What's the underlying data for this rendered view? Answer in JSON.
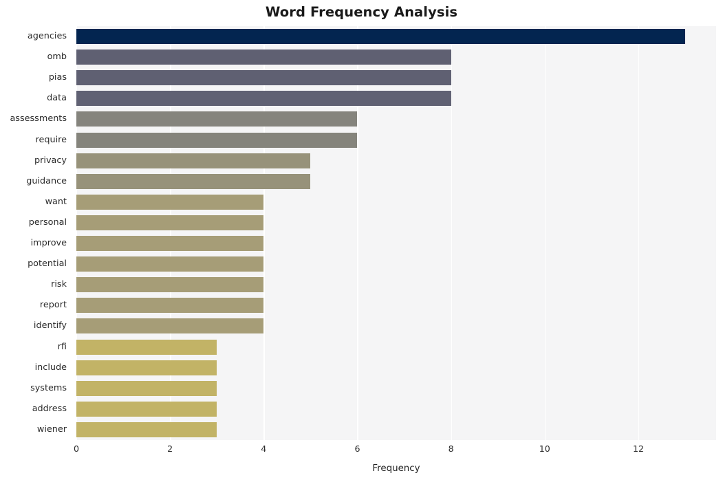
{
  "chart_data": {
    "type": "bar",
    "orientation": "horizontal",
    "title": "Word Frequency Analysis",
    "xlabel": "Frequency",
    "ylabel": "",
    "xlim": [
      0,
      13.66
    ],
    "xticks": [
      0,
      2,
      4,
      6,
      8,
      10,
      12
    ],
    "xticklabels": [
      "0",
      "2",
      "4",
      "6",
      "8",
      "10",
      "12"
    ],
    "grid": "vertical-only",
    "legend": "none",
    "categories": [
      "agencies",
      "omb",
      "pias",
      "data",
      "assessments",
      "require",
      "privacy",
      "guidance",
      "want",
      "personal",
      "improve",
      "potential",
      "risk",
      "report",
      "identify",
      "rfi",
      "include",
      "systems",
      "address",
      "wiener"
    ],
    "values": [
      13,
      8,
      8,
      8,
      6,
      6,
      5,
      5,
      4,
      4,
      4,
      4,
      4,
      4,
      4,
      3,
      3,
      3,
      3,
      3
    ],
    "bar_colors": [
      "#032550",
      "#5f6072",
      "#5f6072",
      "#606173",
      "#85847d",
      "#85847c",
      "#97927a",
      "#97927a",
      "#a69d77",
      "#a69d77",
      "#a69d77",
      "#a69d77",
      "#a69d77",
      "#a69d77",
      "#a69d77",
      "#c2b366",
      "#c2b366",
      "#c2b366",
      "#c2b366",
      "#c2b366"
    ],
    "plot_background": "#f5f5f6",
    "grid_color": "#ffffff",
    "figure_background": "#ffffff"
  }
}
